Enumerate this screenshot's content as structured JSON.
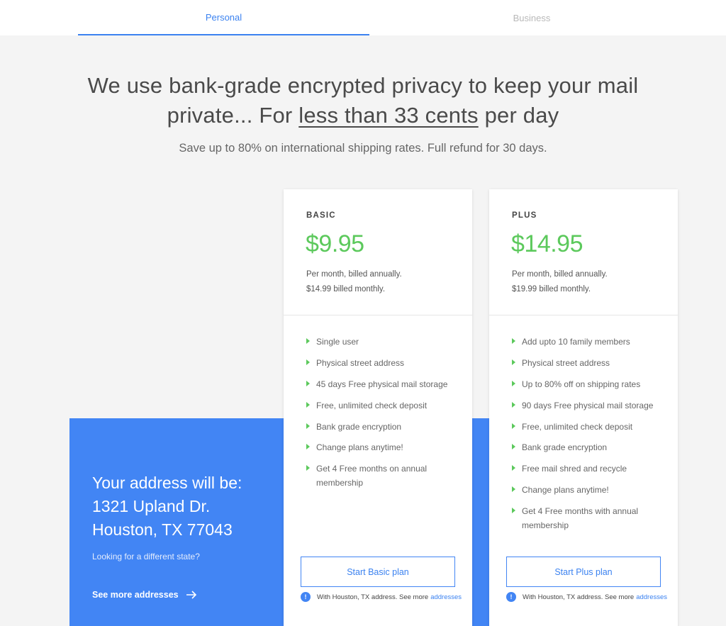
{
  "tabs": [
    {
      "label": "Personal",
      "active": true
    },
    {
      "label": "Business",
      "active": false
    }
  ],
  "hero": {
    "headline_before": "We use bank-grade encrypted privacy to keep your mail private... For",
    "headline_highlight": "less than 33 cents",
    "headline_after": "per day",
    "subline": "Save up to 80% on international shipping rates. Full refund for 30 days."
  },
  "address": {
    "line1": "Your address will be:",
    "line2": "1321 Upland Dr.",
    "line3": "Houston, TX 77043",
    "hint": "Looking for a different state?",
    "see_more_label": "See more addresses"
  },
  "plans": [
    {
      "name": "BASIC",
      "price": "$9.95",
      "billing_line1": "Per month, billed annually.",
      "billing_line2": "$14.99 billed monthly.",
      "features": [
        "Single user",
        "Physical street address",
        "45 days Free physical mail storage",
        "Free, unlimited check deposit",
        "Bank grade encryption",
        "Change plans anytime!",
        "Get 4 Free months on annual membership"
      ],
      "cta_label": "Start Basic plan",
      "note_text": "With Houston, TX address. See more",
      "note_link": "addresses"
    },
    {
      "name": "PLUS",
      "price": "$14.95",
      "billing_line1": "Per month, billed annually.",
      "billing_line2": "$19.99 billed monthly.",
      "features": [
        "Add upto 10 family members",
        "Physical street address",
        "Up to 80% off on shipping rates",
        "90 days Free physical mail storage",
        "Free, unlimited check deposit",
        "Bank grade encryption",
        "Free mail shred and recycle",
        "Change plans anytime!",
        "Get 4 Free months with annual membership"
      ],
      "cta_label": "Start Plus plan",
      "note_text": "With Houston, TX address. See more",
      "note_link": "addresses"
    }
  ],
  "colors": {
    "accent": "#4285f4",
    "price_green": "#5cc95c",
    "inactive_tab": "#b9b9b9"
  },
  "icons": {
    "see_more": "arrow-right-icon",
    "feature_bullet": "triangle-bullet-icon",
    "note": "info-icon"
  }
}
